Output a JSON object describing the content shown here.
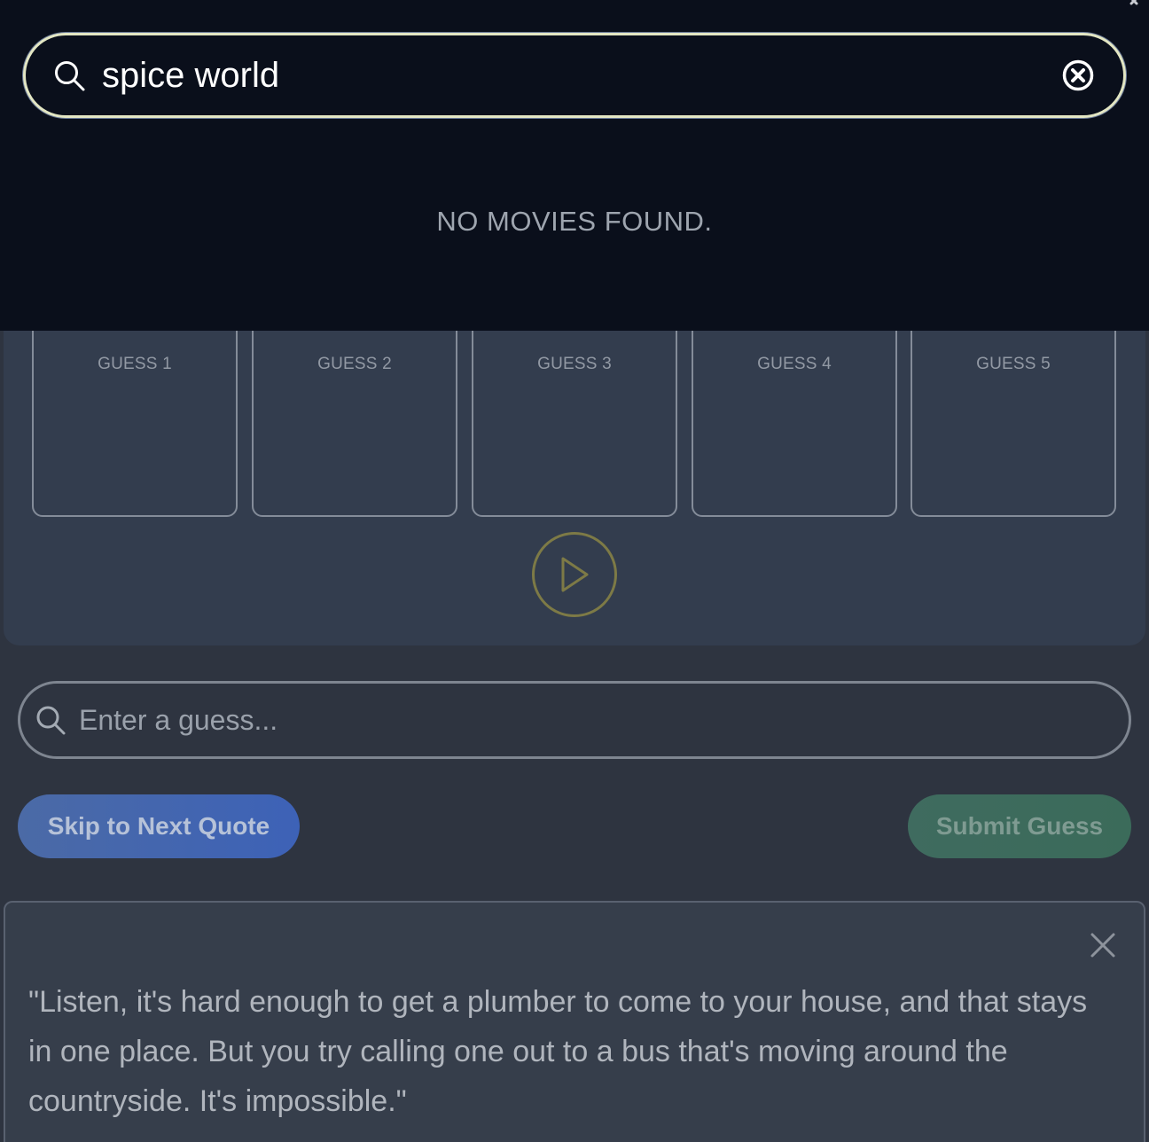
{
  "search": {
    "value": "spice world",
    "no_results": "NO MOVIES FOUND."
  },
  "guesses": [
    {
      "label": "GUESS 1"
    },
    {
      "label": "GUESS 2"
    },
    {
      "label": "GUESS 3"
    },
    {
      "label": "GUESS 4"
    },
    {
      "label": "GUESS 5"
    }
  ],
  "guess_input": {
    "placeholder": "Enter a guess..."
  },
  "buttons": {
    "skip": "Skip to Next Quote",
    "submit": "Submit Guess"
  },
  "quote": {
    "text": "\"Listen, it's hard enough to get a plumber to come to your house, and that stays in one place. But you try calling one out to a bus that's moving around the countryside. It's impossible.\""
  },
  "icons": {
    "search": "search-icon",
    "clear": "clear-circle-x-icon",
    "play": "play-icon",
    "close": "close-icon"
  },
  "colors": {
    "overlay_bg": "#0a0f1b",
    "panel_bg": "#333d4e",
    "page_bg": "#2e3440",
    "skip_button": "#4b6aa6",
    "submit_button": "#3f6b5f",
    "play_ring": "#7d7a46"
  }
}
